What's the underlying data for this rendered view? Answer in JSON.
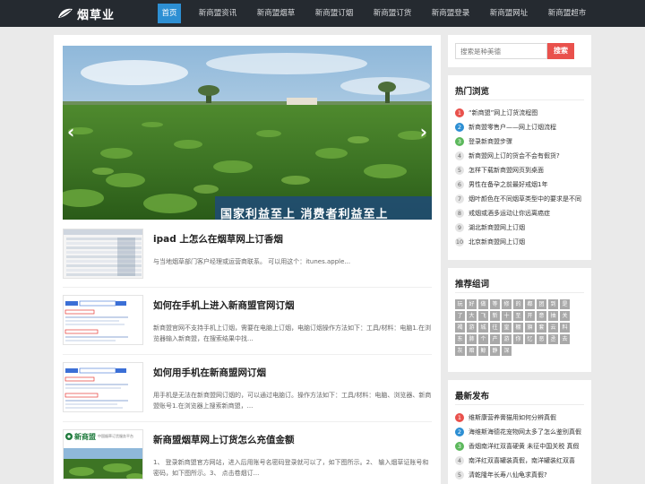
{
  "header": {
    "logo_text": "烟草业",
    "nav": [
      {
        "label": "首页",
        "active": true
      },
      {
        "label": "新商盟资讯",
        "active": false
      },
      {
        "label": "新商盟烟草",
        "active": false
      },
      {
        "label": "新商盟订烟",
        "active": false
      },
      {
        "label": "新商盟订货",
        "active": false
      },
      {
        "label": "新商盟登录",
        "active": false
      },
      {
        "label": "新商盟网址",
        "active": false
      },
      {
        "label": "新商盟超市",
        "active": false
      }
    ]
  },
  "banner": {
    "caption": "国家利益至上  消费者利益至上",
    "prev_icon": "chevron-left-icon",
    "next_icon": "chevron-right-icon"
  },
  "articles": [
    {
      "title": "ipad 上怎么在烟草网上订香烟",
      "excerpt": "与当地烟草部门客户经理或运营商联系。 可以用这个：itunes.apple..."
    },
    {
      "title": "如何在手机上进入新商盟官网订烟",
      "excerpt": "新商盟官网不支持手机上订烟，需要在电脑上订烟，电脑订烟操作方法如下：工具/材料：电脑1.在浏览器输入新商盟，在搜索结果中找..."
    },
    {
      "title": "如何用手机在新商盟网订烟",
      "excerpt": "用手机是无法在新商盟网订烟的，可以通过电脑订。操作方法如下：工具/材料：电脑、浏览器、新商盟账号1.在浏览器上搜索新商盟，..."
    },
    {
      "title": "新商盟烟草网上订货怎么充值金额",
      "excerpt": "1、 登录新商盟官方网站，进入后用账号名密码登录就可以了，如下图所示。2、 输入烟草证账号和密码，如下图所示。3、 点击卷烟订..."
    }
  ],
  "thumb4_brand": "新商盟",
  "thumb4_subtitle": "中国烟草订货服务平台",
  "thumb_label": "新商盟",
  "sidebar": {
    "search_placeholder": "搜索是种美德",
    "search_button": "搜索",
    "hot": {
      "title": "热门浏览",
      "items": [
        "“新商盟”网上订货流程图",
        "新商盟零售户——网上订烟流程",
        "登录新商盟步骤",
        "新商盟网上订的货会不会有假货?",
        "怎样下载新商盟网页到桌面",
        "男性在备孕之前最好戒烟1年",
        "烟叶颜色在不同烟草类型中的要求是不同",
        "戒烟或酒多运动让你远离癌症",
        "湖北新商盟网上订烟",
        "北京新商盟网上订烟"
      ]
    },
    "tags": {
      "title": "推荐组词",
      "items": [
        "玩",
        "好",
        "做",
        "等",
        "修",
        "的",
        "都",
        "团",
        "到",
        "是",
        "了",
        "大",
        "飞",
        "新",
        "十",
        "至",
        "开",
        "意",
        "抽",
        "关",
        "褐",
        "游",
        "城",
        "往",
        "皇",
        "棚",
        "旗",
        "套",
        "云",
        "料",
        "东",
        "肺",
        "个",
        "产",
        "游",
        "你",
        "忆",
        "恶",
        "丞",
        "去",
        "灰",
        "暗",
        "鲸",
        "静",
        "深"
      ]
    },
    "latest": {
      "title": "最新发布",
      "items": [
        "维斯康营养膏猫用如何分辨真假",
        "海维斯海德花宠物网太多了怎么鉴别真假",
        "香烟南洋红双喜硬黄 未征中国关税 真假",
        "南洋红双喜罐装真假，南洋罐装红双喜",
        "清乾隆年长寿八仙龟求真假?"
      ]
    }
  },
  "colors": {
    "topbar": "#252a30",
    "nav_active": "#2d8fd3",
    "search_button": "#e9514c",
    "rank1": "#e9514c",
    "rank2": "#2d8fd3",
    "rank3": "#5cb85c",
    "tag_bg": "#a9a9a9"
  }
}
